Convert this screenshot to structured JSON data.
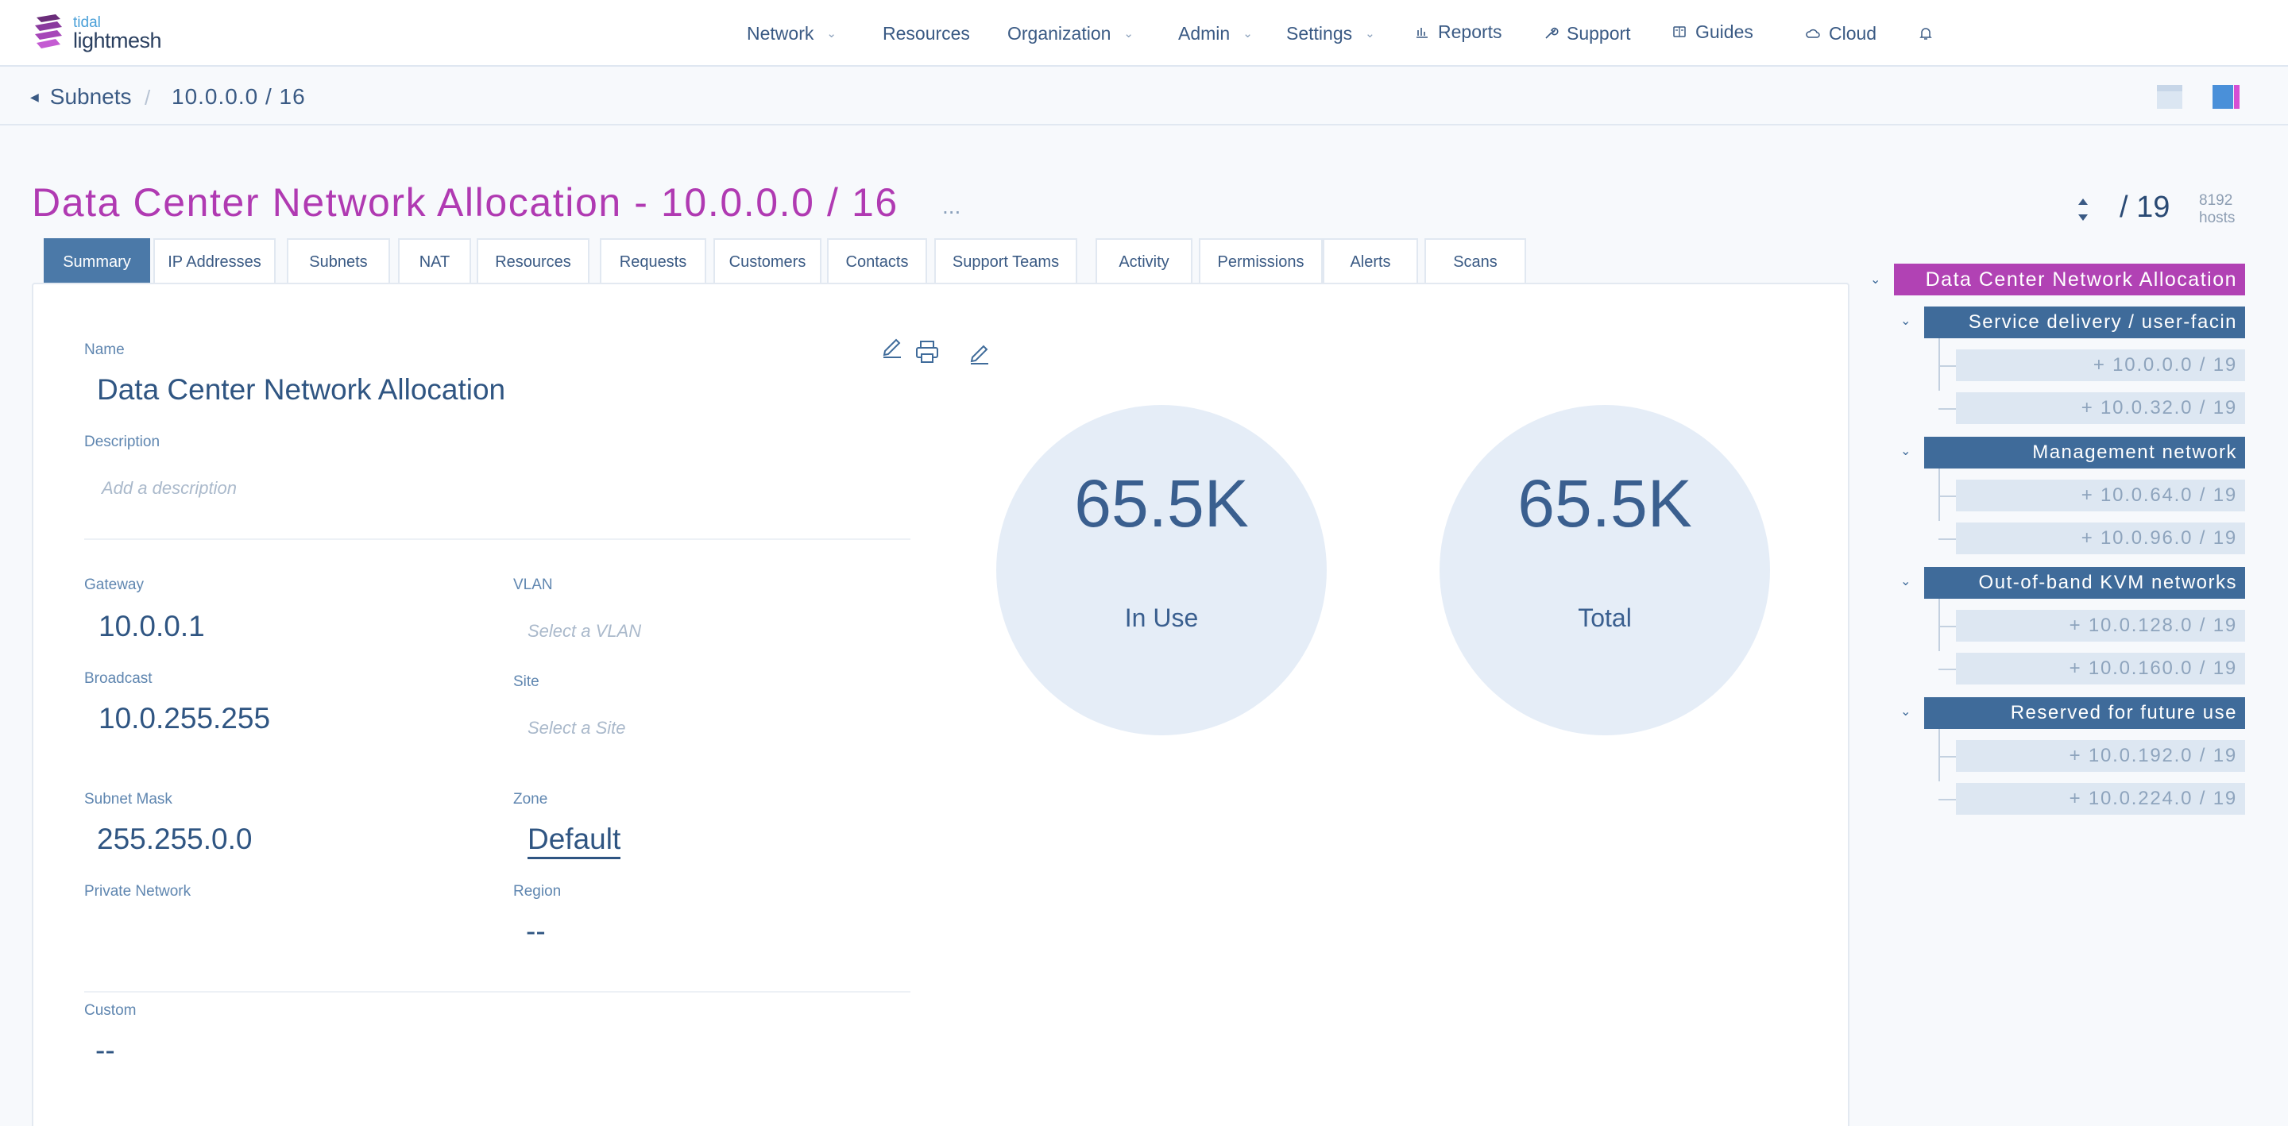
{
  "brand": {
    "small": "tidal",
    "big": "lightmesh"
  },
  "nav": {
    "network": "Network",
    "resources": "Resources",
    "organization": "Organization",
    "admin": "Admin",
    "settings": "Settings",
    "reports": "Reports",
    "support": "Support",
    "guides": "Guides",
    "cloud": "Cloud"
  },
  "breadcrumb": {
    "back": "Subnets",
    "sep": "/",
    "current": "10.0.0.0 / 16"
  },
  "header": {
    "title": "Data Center Network Allocation - 10.0.0.0 / 16",
    "more": "...",
    "prefix": "/ 19",
    "hosts_count": "8192",
    "hosts_label": "hosts"
  },
  "tabs": [
    "Summary",
    "IP Addresses",
    "Subnets",
    "NAT",
    "Resources",
    "Requests",
    "Customers",
    "Contacts",
    "Support Teams",
    "Activity",
    "Permissions",
    "Alerts",
    "Scans"
  ],
  "summary": {
    "name_label": "Name",
    "name_value": "Data Center Network Allocation",
    "description_label": "Description",
    "description_placeholder": "Add a description",
    "gateway_label": "Gateway",
    "gateway_value": "10.0.0.1",
    "vlan_label": "VLAN",
    "vlan_placeholder": "Select a VLAN",
    "broadcast_label": "Broadcast",
    "broadcast_value": "10.0.255.255",
    "site_label": "Site",
    "site_placeholder": "Select a Site",
    "mask_label": "Subnet Mask",
    "mask_value": "255.255.0.0",
    "zone_label": "Zone",
    "zone_value": "Default",
    "private_label": "Private Network",
    "region_label": "Region",
    "region_value": "--",
    "custom_label": "Custom",
    "custom_value": "--"
  },
  "stats": {
    "in_use_value": "65.5K",
    "in_use_label": "In Use",
    "total_value": "65.5K",
    "total_label": "Total"
  },
  "tree": {
    "root": "Data Center Network Allocation",
    "groups": [
      {
        "label": "Service delivery / user-facin",
        "leaves": [
          "+ 10.0.0.0 / 19",
          "+ 10.0.32.0 / 19"
        ]
      },
      {
        "label": "Management network",
        "leaves": [
          "+ 10.0.64.0 / 19",
          "+ 10.0.96.0 / 19"
        ]
      },
      {
        "label": "Out-of-band KVM networks",
        "leaves": [
          "+ 10.0.128.0 / 19",
          "+ 10.0.160.0 / 19"
        ]
      },
      {
        "label": "Reserved for future use",
        "leaves": [
          "+ 10.0.192.0 / 19",
          "+ 10.0.224.0 / 19"
        ]
      }
    ]
  },
  "colors": {
    "accent_magenta": "#b03ab2",
    "primary_blue": "#4b79a8",
    "tree_blue": "#3f6b9a",
    "leaf_bg": "#dde7f2",
    "circle_bg": "#e5edf7"
  }
}
